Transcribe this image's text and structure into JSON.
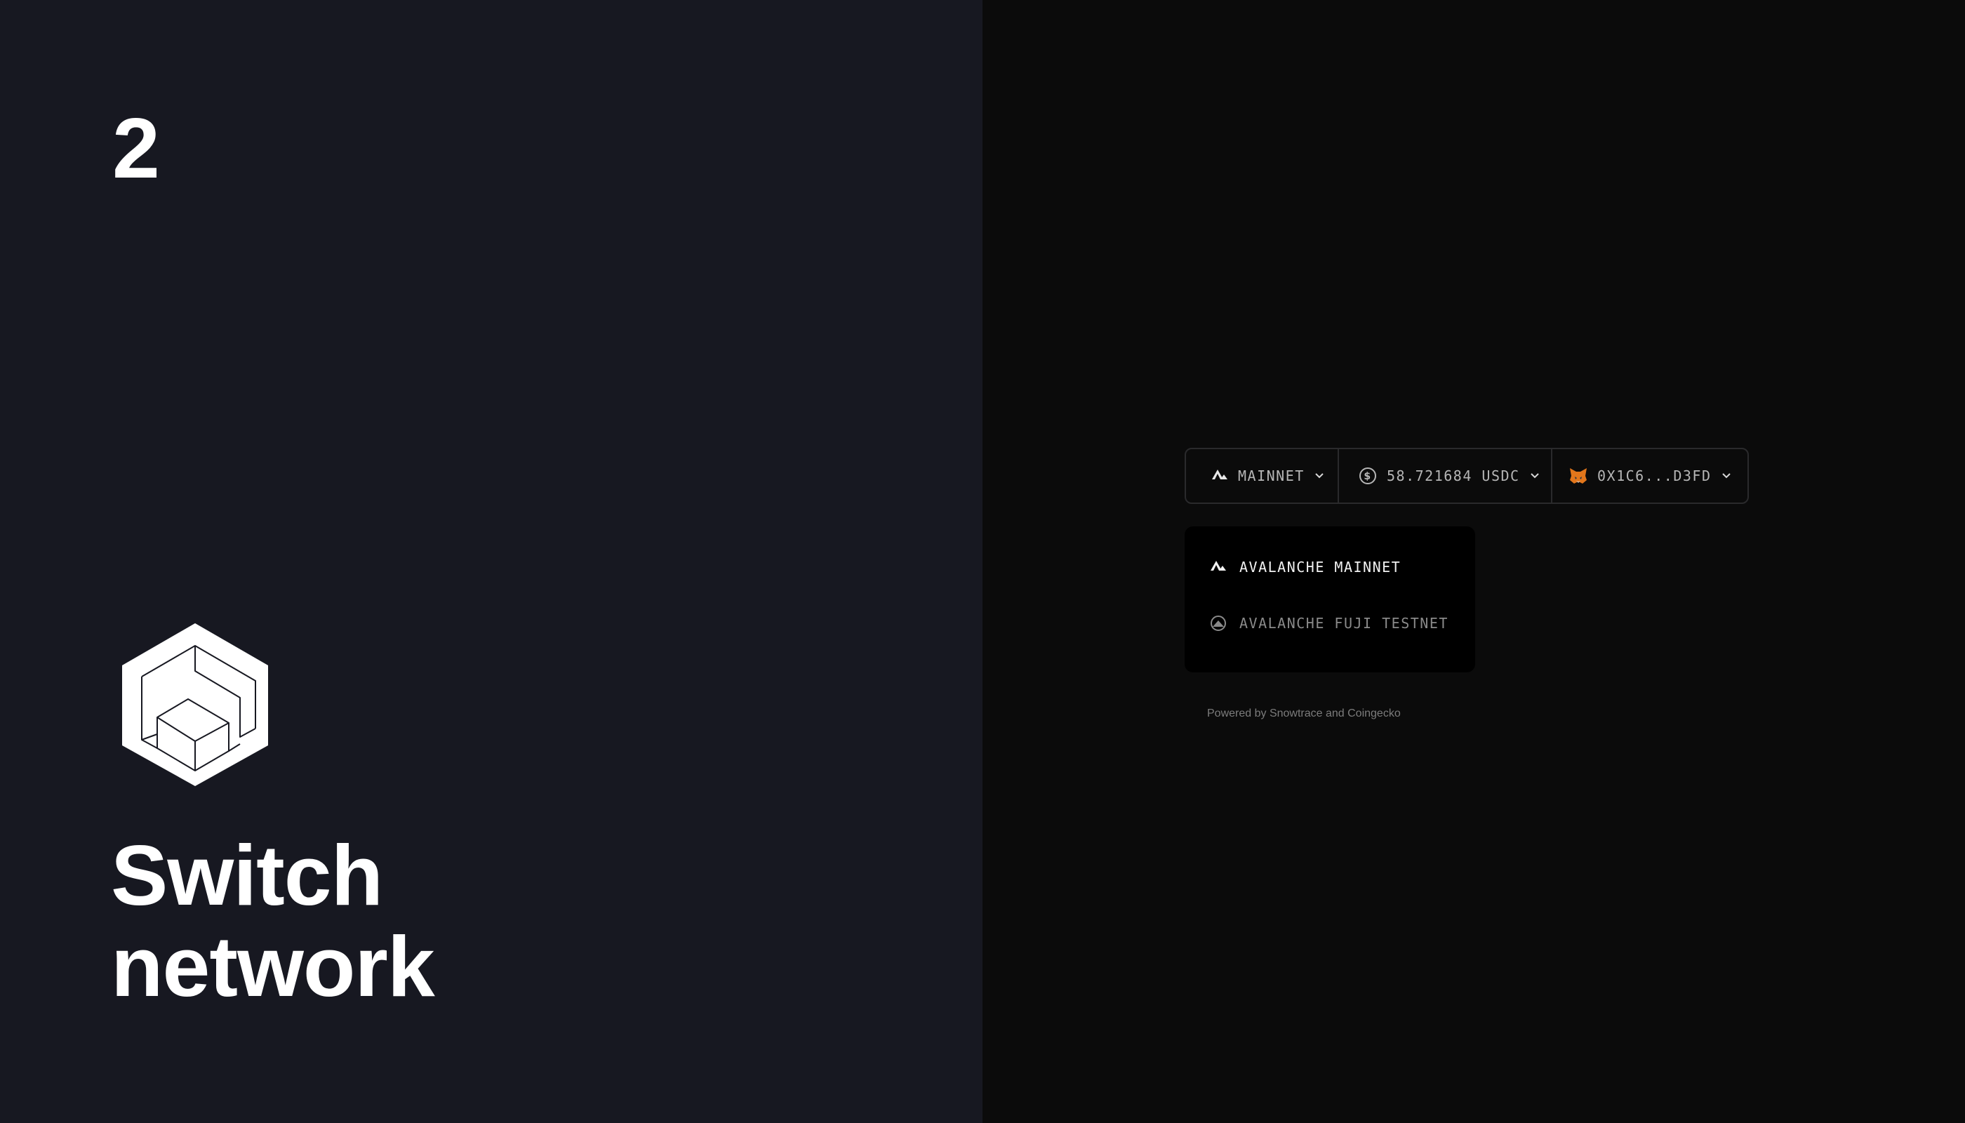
{
  "step": {
    "number": "2"
  },
  "headline": {
    "line1": "Switch",
    "line2": "network"
  },
  "toolbar": {
    "network": {
      "label": "MAINNET",
      "icon": "avalanche-icon"
    },
    "balance": {
      "label": "58.721684 USDC",
      "icon": "usdc-icon"
    },
    "wallet": {
      "label": "0X1C6...D3FD",
      "icon": "metamask-fox-icon"
    }
  },
  "network_menu": {
    "items": [
      {
        "label": "AVALANCHE MAINNET",
        "icon": "avalanche-icon",
        "selected": true
      },
      {
        "label": "AVALANCHE FUJI TESTNET",
        "icon": "fuji-icon",
        "selected": false
      }
    ]
  },
  "footer": {
    "powered_by": "Powered by Snowtrace and Coingecko"
  },
  "colors": {
    "left_background": "#171821",
    "right_background": "#0b0b0b",
    "text_primary": "#ffffff",
    "text_muted": "#8a8a8a",
    "border": "#2a2a2c",
    "metamask_orange": "#e2761b"
  }
}
